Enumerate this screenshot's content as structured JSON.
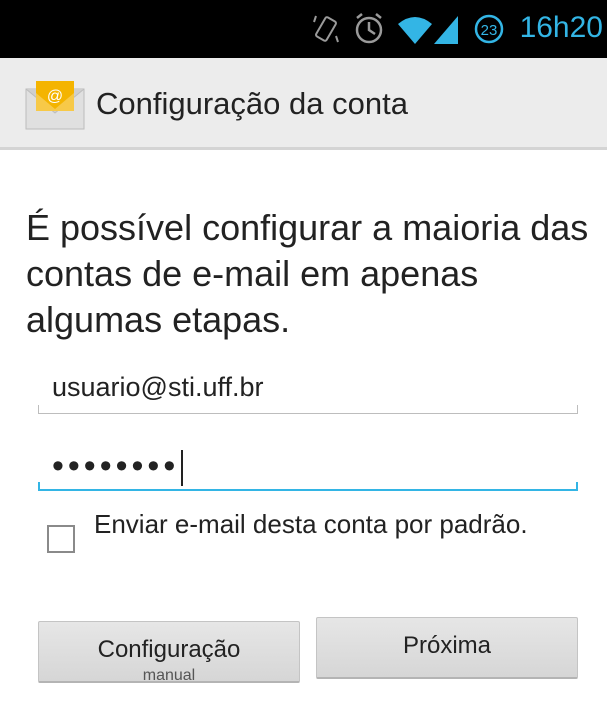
{
  "status_bar": {
    "time": "16h20",
    "notification_badge": "23",
    "icons": [
      "vibrate-icon",
      "alarm-icon",
      "wifi-icon",
      "cell-signal-icon",
      "badge-icon"
    ],
    "accent_color": "#33b5e5"
  },
  "action_bar": {
    "title": "Configuração da conta",
    "app_icon": "email-envelope-icon"
  },
  "main": {
    "heading": "É possível configurar a maioria das contas de e-mail em apenas algumas etapas.",
    "email_value": "usuario@sti.uff.br",
    "password_mask": "••••••••",
    "checkbox_label": "Enviar e-mail desta conta por padrão.",
    "checkbox_checked": false
  },
  "buttons": {
    "manual_setup": "Configuração",
    "manual_setup_sub": "manual",
    "next": "Próxima"
  }
}
